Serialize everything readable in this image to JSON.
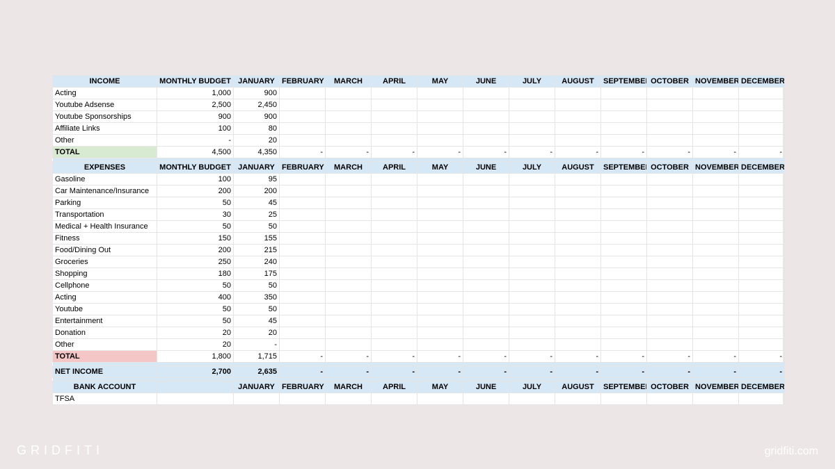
{
  "columns": {
    "category_blank": "",
    "budget": "MONTHLY BUDGET",
    "bank_budget_blank": "",
    "months": [
      "JANUARY",
      "FEBRUARY",
      "MARCH",
      "APRIL",
      "MAY",
      "JUNE",
      "JULY",
      "AUGUST",
      "SEPTEMBER",
      "OCTOBER",
      "NOVEMBER",
      "DECEMBER"
    ]
  },
  "income": {
    "title": "INCOME",
    "rows": [
      {
        "label": "Acting",
        "budget": "1,000",
        "jan": "900"
      },
      {
        "label": "Youtube Adsense",
        "budget": "2,500",
        "jan": "2,450"
      },
      {
        "label": "Youtube Sponsorships",
        "budget": "900",
        "jan": "900"
      },
      {
        "label": "Affiliate Links",
        "budget": "100",
        "jan": "80"
      },
      {
        "label": "Other",
        "budget": "-",
        "jan": "20"
      }
    ],
    "total": {
      "label": "TOTAL",
      "budget": "4,500",
      "months": [
        "4,350",
        "-",
        "-",
        "-",
        "-",
        "-",
        "-",
        "-",
        "-",
        "-",
        "-",
        "-"
      ]
    }
  },
  "expenses": {
    "title": "EXPENSES",
    "rows": [
      {
        "label": "Gasoline",
        "budget": "100",
        "jan": "95"
      },
      {
        "label": "Car Maintenance/Insurance",
        "budget": "200",
        "jan": "200"
      },
      {
        "label": "Parking",
        "budget": "50",
        "jan": "45"
      },
      {
        "label": "Transportation",
        "budget": "30",
        "jan": "25"
      },
      {
        "label": "Medical + Health Insurance",
        "budget": "50",
        "jan": "50"
      },
      {
        "label": "Fitness",
        "budget": "150",
        "jan": "155"
      },
      {
        "label": "Food/Dining Out",
        "budget": "200",
        "jan": "215"
      },
      {
        "label": "Groceries",
        "budget": "250",
        "jan": "240"
      },
      {
        "label": "Shopping",
        "budget": "180",
        "jan": "175"
      },
      {
        "label": "Cellphone",
        "budget": "50",
        "jan": "50"
      },
      {
        "label": "Acting",
        "budget": "400",
        "jan": "350"
      },
      {
        "label": "Youtube",
        "budget": "50",
        "jan": "50"
      },
      {
        "label": "Entertainment",
        "budget": "50",
        "jan": "45"
      },
      {
        "label": "Donation",
        "budget": "20",
        "jan": "20"
      },
      {
        "label": "Other",
        "budget": "20",
        "jan": "-"
      }
    ],
    "total": {
      "label": "TOTAL",
      "budget": "1,800",
      "months": [
        "1,715",
        "-",
        "-",
        "-",
        "-",
        "-",
        "-",
        "-",
        "-",
        "-",
        "-",
        "-"
      ]
    }
  },
  "net_income": {
    "label": "NET INCOME",
    "budget": "2,700",
    "months": [
      "2,635",
      "-",
      "-",
      "-",
      "-",
      "-",
      "-",
      "-",
      "-",
      "-",
      "-",
      "-"
    ]
  },
  "bank": {
    "title": "BANK ACCOUNT",
    "rows": [
      {
        "label": "TFSA"
      }
    ]
  },
  "footer": {
    "brand": "GRIDFITI",
    "url": "gridfiti.com"
  }
}
